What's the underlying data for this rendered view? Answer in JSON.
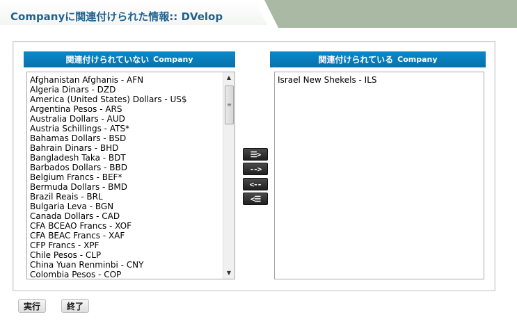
{
  "header": {
    "title": "Companyに関連付けられた情報:: DVelop"
  },
  "columns": {
    "unassigned": {
      "label": "関連付けられていない",
      "brand": "Company"
    },
    "assigned": {
      "label": "関連付けられている",
      "brand": "Company"
    }
  },
  "unassigned_items": [
    "Afghanistan Afghanis - AFN",
    "Algeria Dinars - DZD",
    "America (United States) Dollars - US$",
    "Argentina Pesos - ARS",
    "Australia Dollars - AUD",
    "Austria Schillings - ATS*",
    "Bahamas Dollars - BSD",
    "Bahrain Dinars - BHD",
    "Bangladesh Taka - BDT",
    "Barbados Dollars - BBD",
    "Belgium Francs - BEF*",
    "Bermuda Dollars - BMD",
    "Brazil Reais - BRL",
    "Bulgaria Leva - BGN",
    "Canada Dollars - CAD",
    "CFA BCEAO Francs - XOF",
    "CFA BEAC Francs - XAF",
    "CFP Francs - XPF",
    "Chile Pesos - CLP",
    "China Yuan Renminbi - CNY",
    "Colombia Pesos - COP"
  ],
  "assigned_items": [
    "Israel New Shekels - ILS"
  ],
  "transfer_buttons": {
    "add_all": "☰>",
    "add_one": "-->",
    "remove_one": "<--",
    "remove_all": "<☰"
  },
  "actions": {
    "run": "実行",
    "close": "終了"
  },
  "icons": {
    "scroll_up": "scroll-up-arrow-icon",
    "scroll_down": "scroll-down-arrow-icon"
  },
  "colors": {
    "title": "#21628f",
    "column_header": "#0a88c8",
    "header_strip": "#a9b9a4"
  }
}
